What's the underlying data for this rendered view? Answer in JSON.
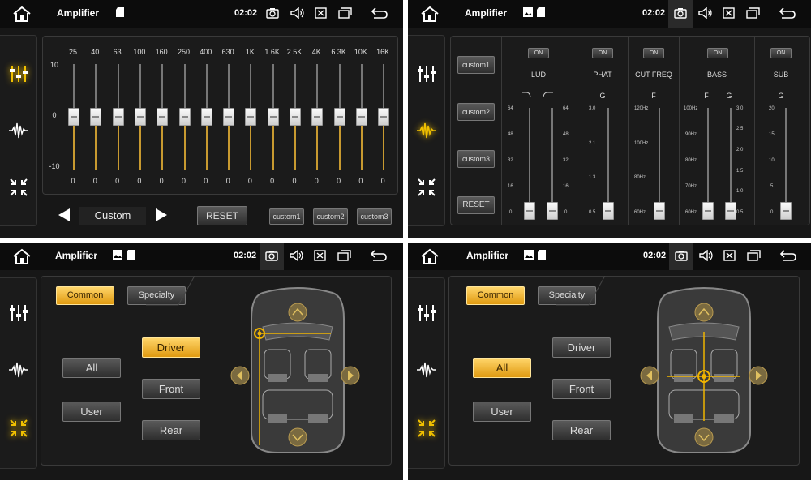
{
  "status": {
    "title": "Amplifier",
    "time": "02:02"
  },
  "eq": {
    "freqs": [
      "25",
      "40",
      "63",
      "100",
      "160",
      "250",
      "400",
      "630",
      "1K",
      "1.6K",
      "2.5K",
      "4K",
      "6.3K",
      "10K",
      "16K"
    ],
    "values": [
      0,
      0,
      0,
      0,
      0,
      0,
      0,
      0,
      0,
      0,
      0,
      0,
      0,
      0,
      0
    ],
    "scale": {
      "top": "10",
      "mid": "0",
      "bottom": "-10"
    },
    "preset": "Custom",
    "reset": "RESET",
    "custom_buttons": [
      "custom1",
      "custom2",
      "custom3"
    ]
  },
  "filter": {
    "side_buttons": [
      "custom1",
      "custom2",
      "custom3",
      "RESET"
    ],
    "toggle_label": "ON",
    "groups": [
      {
        "name": "LUD",
        "sublabel": "",
        "scale": [
          "64",
          "48",
          "32",
          "16",
          "0"
        ],
        "scale_right": [
          "64",
          "48",
          "32",
          "16",
          "0"
        ]
      },
      {
        "name": "PHAT",
        "sublabel": "G",
        "scale": [
          "3.0",
          "2.1",
          "1.3",
          "0.5"
        ]
      },
      {
        "name": "CUT FREQ",
        "sublabel": "F",
        "scale": [
          "120Hz",
          "100Hz",
          "80Hz",
          "60Hz"
        ]
      },
      {
        "name": "BASS",
        "sublabel": "F",
        "sublabel2": "G",
        "scale": [
          "100Hz",
          "90Hz",
          "80Hz",
          "70Hz",
          "60Hz"
        ],
        "scale_right": [
          "3.0",
          "2.5",
          "2.0",
          "1.5",
          "1.0",
          "0.5"
        ]
      },
      {
        "name": "SUB",
        "sublabel": "G",
        "scale": [
          "20",
          "15",
          "10",
          "5",
          "0"
        ]
      }
    ]
  },
  "balance": {
    "tabs": [
      "Common",
      "Specialty"
    ],
    "left_buttons": [
      "All",
      "User"
    ],
    "right_buttons": [
      "Driver",
      "Front",
      "Rear"
    ]
  },
  "colors": {
    "accent": "#f0b400",
    "panel": "#171717"
  }
}
